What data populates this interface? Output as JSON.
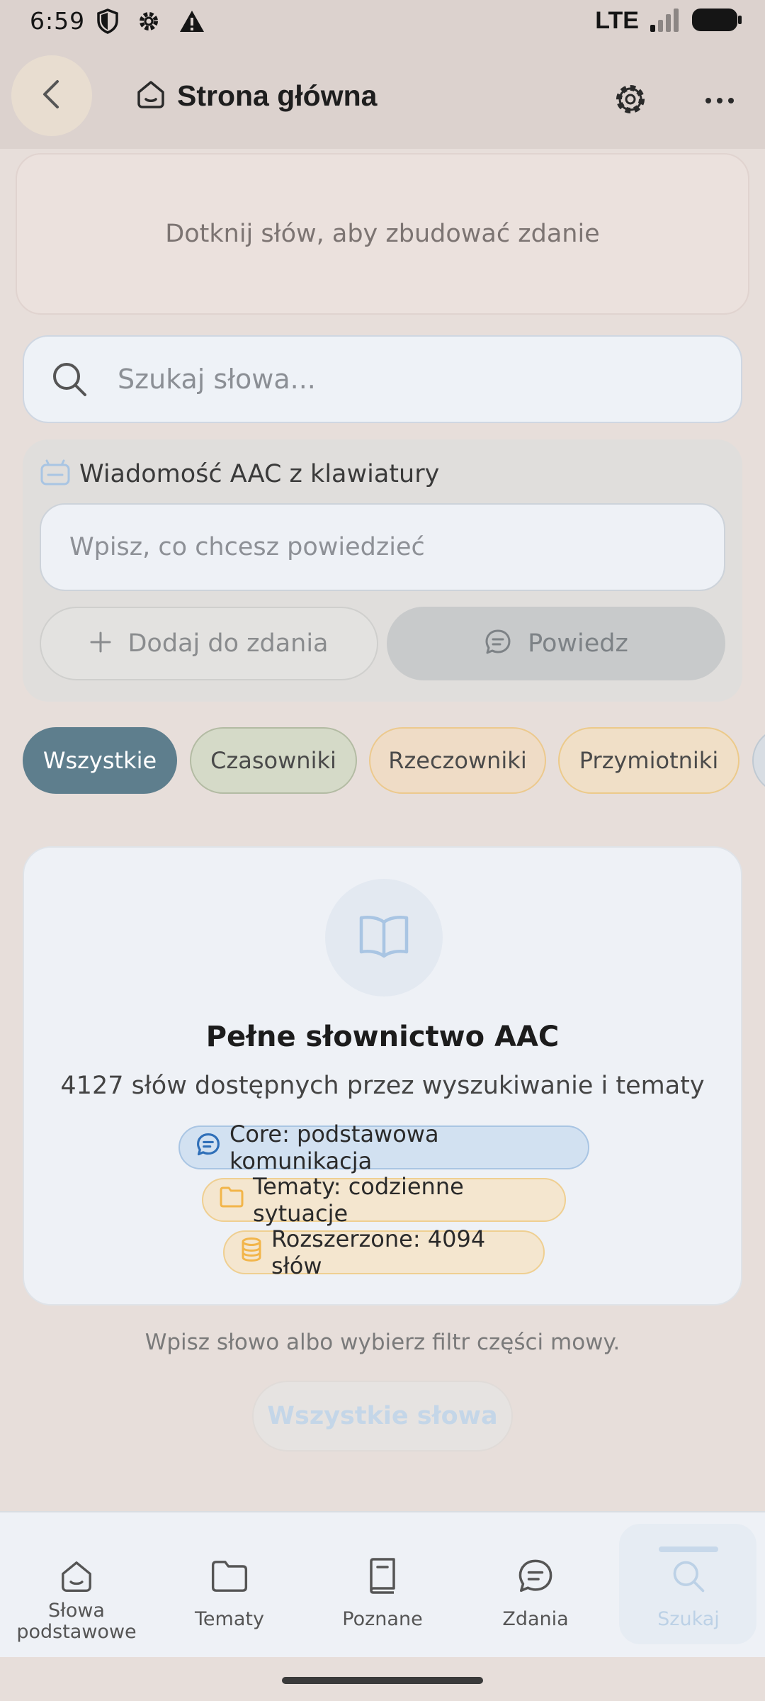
{
  "status_bar": {
    "time": "6:59",
    "network": "LTE"
  },
  "app_bar": {
    "title": "Strona główna"
  },
  "sentence": {
    "hint": "Dotknij słów, aby zbudować zdanie"
  },
  "search": {
    "placeholder": "Szukaj słowa..."
  },
  "keyboard_panel": {
    "title": "Wiadomość AAC z klawiatury",
    "input_placeholder": "Wpisz, co chcesz powiedzieć",
    "add_label": "Dodaj do zdania",
    "say_label": "Powiedz"
  },
  "filters": [
    {
      "label": "Wszystkie",
      "selected": true
    },
    {
      "label": "Czasowniki",
      "selected": false
    },
    {
      "label": "Rzeczowniki",
      "selected": false
    },
    {
      "label": "Przymiotniki",
      "selected": false
    }
  ],
  "vocab_card": {
    "title": "Pełne słownictwo AAC",
    "subtitle": "4127 słów dostępnych przez wyszukiwanie i tematy",
    "pills": [
      {
        "label": "Core: podstawowa komunikacja",
        "icon": "chat-icon"
      },
      {
        "label": "Tematy: codzienne sytuacje",
        "icon": "folder-icon"
      },
      {
        "label": "Rozszerzone: 4094 słów",
        "icon": "database-icon"
      }
    ]
  },
  "hint": "Wpisz słowo albo wybierz filtr części mowy.",
  "all_words_button": "Wszystkie słowa",
  "bottom_nav": [
    {
      "label": "Słowa podstawowe",
      "icon": "home-icon",
      "active": false
    },
    {
      "label": "Tematy",
      "icon": "folder-icon",
      "active": false
    },
    {
      "label": "Poznane",
      "icon": "book-icon",
      "active": false
    },
    {
      "label": "Zdania",
      "icon": "chat-icon",
      "active": false
    },
    {
      "label": "Szukaj",
      "icon": "search-icon",
      "active": true
    }
  ],
  "colors": {
    "accent": "#5e7e8d",
    "background": "#e7deda",
    "card": "#eef1f6",
    "core_blue": "#2f6fb8",
    "topic_orange": "#f2b54a"
  }
}
